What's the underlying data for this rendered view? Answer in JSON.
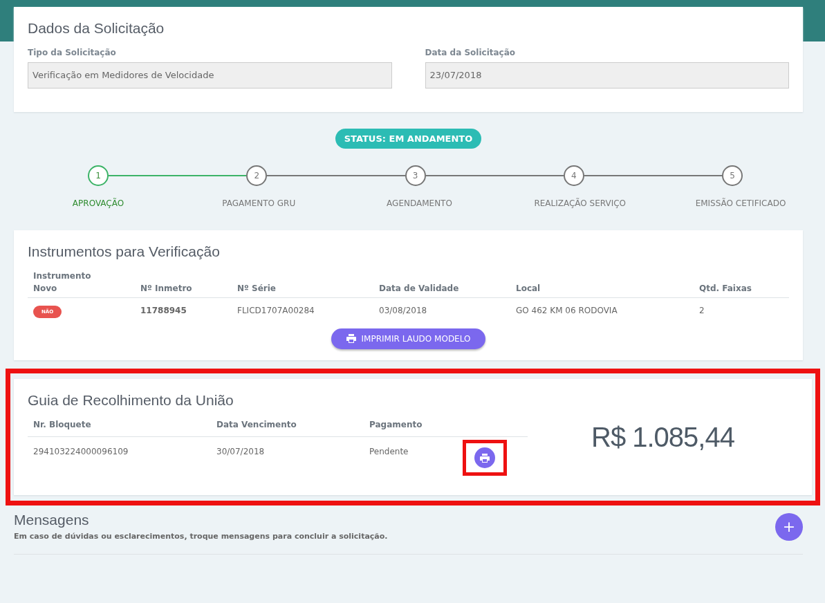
{
  "request": {
    "title": "Dados da Solicitação",
    "fields": [
      {
        "label": "Tipo da Solicitação",
        "value": "Verificação em Medidores de Velocidade"
      },
      {
        "label": "Data da Solicitação",
        "value": "23/07/2018"
      }
    ]
  },
  "status": "STATUS: EM ANDAMENTO",
  "steps": [
    {
      "number": "1",
      "label": "APROVAÇÃO",
      "done": true
    },
    {
      "number": "2",
      "label": "PAGAMENTO GRU",
      "done": false
    },
    {
      "number": "3",
      "label": "AGENDAMENTO",
      "done": false
    },
    {
      "number": "4",
      "label": "REALIZAÇÃO SERVIÇO",
      "done": false
    },
    {
      "number": "5",
      "label": "EMISSÃO CETIFICADO",
      "done": false
    }
  ],
  "instruments": {
    "title": "Instrumentos para Verificação",
    "columns": [
      "Instrumento Novo",
      "Nº Inmetro",
      "Nº Série",
      "Data de Validade",
      "Local",
      "Qtd. Faixas"
    ],
    "rows": [
      {
        "novo": "NÃO",
        "inmetro": "11788945",
        "serie": "FLICD1707A00284",
        "validade": "03/08/2018",
        "local": "GO 462 KM 06 RODOVIA",
        "faixas": "2"
      }
    ],
    "button": "IMPRIMIR LAUDO MODELO"
  },
  "gru": {
    "title": "Guia de Recolhimento da União",
    "highlighted": true,
    "columns": [
      "Nr. Bloquete",
      "Data Vencimento",
      "Pagamento"
    ],
    "rows": [
      {
        "bloquete": "294103224000096109",
        "vencimento": "30/07/2018",
        "pagamento": "Pendente",
        "print_highlighted": true
      }
    ],
    "total": "R$ 1.085,44"
  },
  "messages": {
    "title": "Mensagens",
    "hint": "Em caso de dúvidas ou esclarecimentos, troque mensagens para concluir a solicitação.",
    "add": "+"
  }
}
